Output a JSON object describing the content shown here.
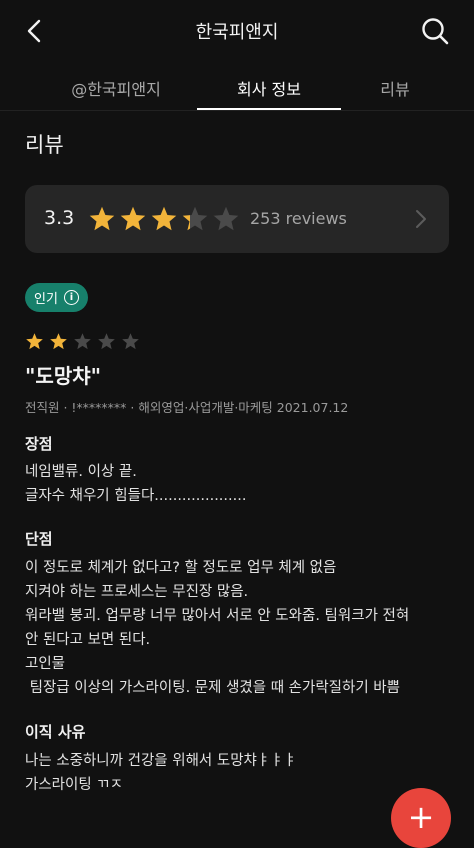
{
  "header": {
    "title": "한국피앤지",
    "back_icon": "chevron-left-icon",
    "search_icon": "search-icon"
  },
  "tabs": [
    {
      "label": "@한국피앤지",
      "active": false
    },
    {
      "label": "회사 정보",
      "active": true
    },
    {
      "label": "리뷰",
      "active": false
    }
  ],
  "section_title": "리뷰",
  "rating_summary": {
    "score": "3.3",
    "stars": 3.3,
    "max_stars": 5,
    "reviews_label": "253 reviews"
  },
  "review": {
    "badge": "인기",
    "stars": 2,
    "title": "\"도망챠\"",
    "meta": "전직원 · !******** · 해외영업·사업개발·마케팅 2021.07.12",
    "pros_label": "장점",
    "pros_lines": [
      "네임밸류. 이상 끝.",
      "글자수 채우기 힘들다...................."
    ],
    "cons_label": "단점",
    "cons_lines": [
      "이 정도로 체계가 없다고? 할 정도로 업무 체계 없음",
      "지켜야 하는 프로세스는 무진장 많음.",
      "워라밸 붕괴. 업무량 너무 많아서 서로 안 도와줌. 팀워크가 전혀",
      "안 된다고 보면 된다.",
      "고인물",
      " 팀장급 이상의 가스라이팅. 문제 생겼을 때 손가락질하기 바쁨"
    ],
    "reason_label": "이직 사유",
    "reason_lines": [
      "나는 소중하니까 건강을 위해서 도망챠ㅑㅑㅑ",
      "가스라이팅 ㄲㅈ"
    ]
  },
  "fab": {
    "label": "+"
  },
  "colors": {
    "background": "#111111",
    "star": "#f2b43a",
    "star_empty": "#4a4a4a",
    "badge": "#17806b",
    "fab": "#e8453c"
  }
}
